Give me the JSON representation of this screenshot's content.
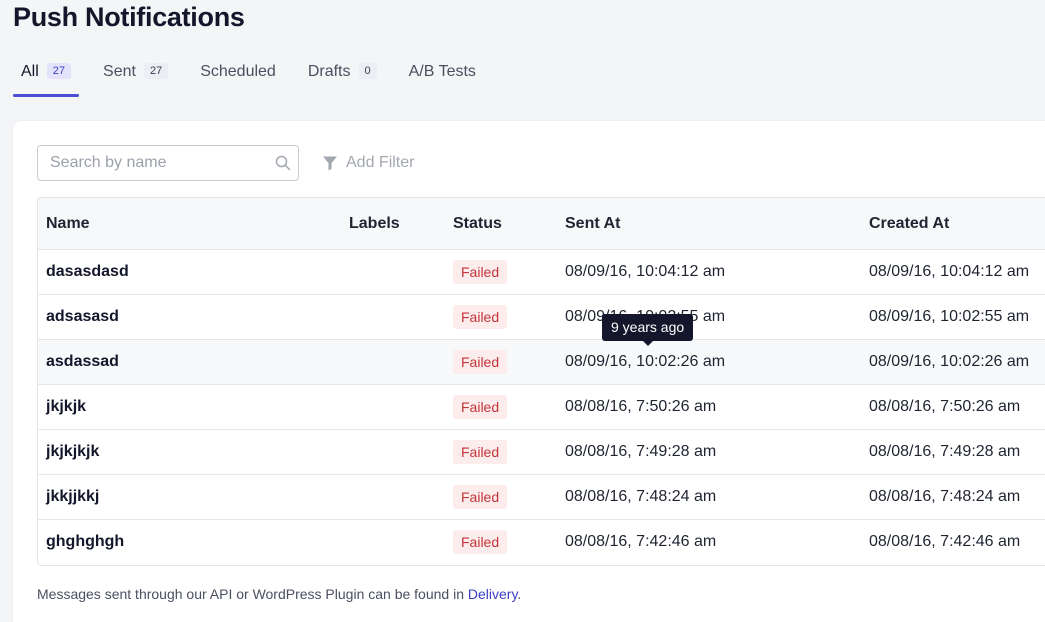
{
  "page": {
    "title": "Push Notifications"
  },
  "tabs": [
    {
      "label": "All",
      "count": "27"
    },
    {
      "label": "Sent",
      "count": "27"
    },
    {
      "label": "Scheduled"
    },
    {
      "label": "Drafts",
      "count": "0"
    },
    {
      "label": "A/B Tests"
    }
  ],
  "search": {
    "placeholder": "Search by name",
    "icon": "search-icon"
  },
  "filter": {
    "label": "Add Filter",
    "icon": "filter-icon"
  },
  "table": {
    "columns": [
      "Name",
      "Labels",
      "Status",
      "Sent At",
      "Created At"
    ],
    "rows": [
      {
        "name": "dasasdasd",
        "labels": "",
        "status": "Failed",
        "sent_at": "08/09/16, 10:04:12 am",
        "created_at": "08/09/16, 10:04:12 am"
      },
      {
        "name": "adsasasd",
        "labels": "",
        "status": "Failed",
        "sent_at": "08/09/16, 10:02:55 am",
        "created_at": "08/09/16, 10:02:55 am"
      },
      {
        "name": "asdassad",
        "labels": "",
        "status": "Failed",
        "sent_at": "08/09/16, 10:02:26 am",
        "created_at": "08/09/16, 10:02:26 am"
      },
      {
        "name": "jkjkjk",
        "labels": "",
        "status": "Failed",
        "sent_at": "08/08/16, 7:50:26 am",
        "created_at": "08/08/16, 7:50:26 am"
      },
      {
        "name": "jkjkjkjk",
        "labels": "",
        "status": "Failed",
        "sent_at": "08/08/16, 7:49:28 am",
        "created_at": "08/08/16, 7:49:28 am"
      },
      {
        "name": "jkkjjkkj",
        "labels": "",
        "status": "Failed",
        "sent_at": "08/08/16, 7:48:24 am",
        "created_at": "08/08/16, 7:48:24 am"
      },
      {
        "name": "ghghghgh",
        "labels": "",
        "status": "Failed",
        "sent_at": "08/08/16, 7:42:46 am",
        "created_at": "08/08/16, 7:42:46 am"
      }
    ]
  },
  "tooltip": {
    "text": "9 years ago"
  },
  "footnote": {
    "text": "Messages sent through our API or WordPress Plugin can be found in ",
    "link": "Delivery",
    "suffix": "."
  },
  "colors": {
    "accent": "#4b4fd3",
    "failed_bg": "#fdecec",
    "failed_text": "#c2353a",
    "link": "#3b3fc2"
  }
}
